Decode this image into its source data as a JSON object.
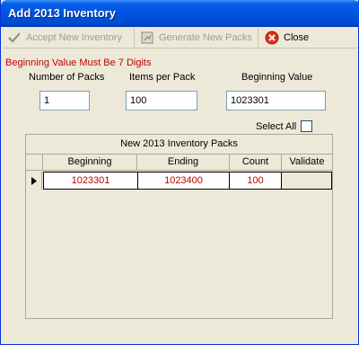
{
  "window": {
    "title": "Add 2013 Inventory"
  },
  "toolbar": {
    "accept_label": "Accept New Inventory",
    "generate_label": "Generate New Packs",
    "close_label": "Close"
  },
  "form": {
    "warning": "Beginning Value Must Be 7 Digits",
    "packs_label": "Number of Packs",
    "packs_value": "1",
    "items_label": "Items per Pack",
    "items_value": "100",
    "begin_label": "Beginning Value",
    "begin_value": "1023301",
    "select_all_label": "Select All",
    "select_all_checked": false
  },
  "grid": {
    "caption": "New 2013 Inventory Packs",
    "columns": [
      "Beginning",
      "Ending",
      "Count",
      "Validate"
    ],
    "rows": [
      {
        "beginning": "1023301",
        "ending": "1023400",
        "count": "100",
        "validate": ""
      }
    ]
  },
  "colors": {
    "title_bar": "#0054e3",
    "warning": "#c00000",
    "cell_text": "#c00000",
    "close_icon": "#e0311c"
  }
}
